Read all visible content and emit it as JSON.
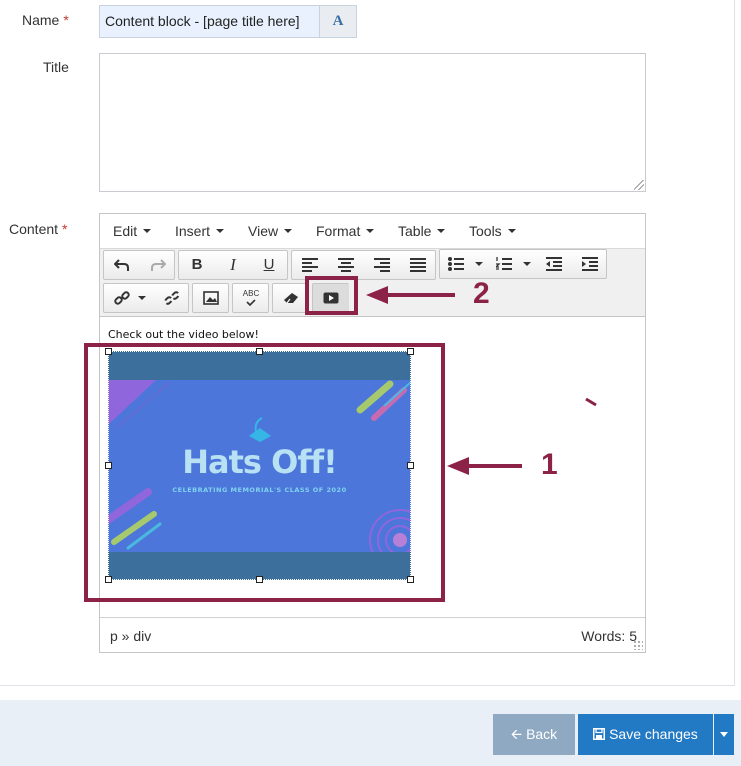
{
  "form": {
    "name_label": "Name",
    "required_mark": "*",
    "name_value": "Content block - [page title here]",
    "name_button_glyph": "A",
    "title_label": "Title",
    "title_value": "",
    "content_label": "Content"
  },
  "editor": {
    "menu": [
      "Edit",
      "Insert",
      "View",
      "Format",
      "Table",
      "Tools"
    ],
    "toolbar_icons": [
      "undo-icon",
      "redo-icon",
      "bold-icon",
      "italic-icon",
      "underline-icon",
      "align-left-icon",
      "align-center-icon",
      "align-right-icon",
      "justify-icon",
      "bullet-list-icon",
      "numbered-list-icon",
      "outdent-icon",
      "indent-icon",
      "link-icon",
      "unlink-icon",
      "image-icon",
      "spellcheck-icon",
      "eraser-icon",
      "video-icon"
    ],
    "bold_glyph": "B",
    "italic_glyph": "I",
    "underline_glyph": "U",
    "spellcheck_glyph": "ABC",
    "content_text": "Check out the video below!",
    "video": {
      "title": "Hats Off!",
      "subtitle": "CELEBRATING MEMORIAL'S CLASS OF 2020"
    },
    "status_path": "p » div",
    "word_count": "Words: 5"
  },
  "annotations": {
    "label_1": "1",
    "label_2": "2",
    "color": "#8c2248"
  },
  "footer": {
    "back_label": "Back",
    "save_label": "Save changes"
  },
  "colors": {
    "accent": "#2279c4",
    "back": "#8fa9c3",
    "footer_bg": "#e9eff6"
  }
}
